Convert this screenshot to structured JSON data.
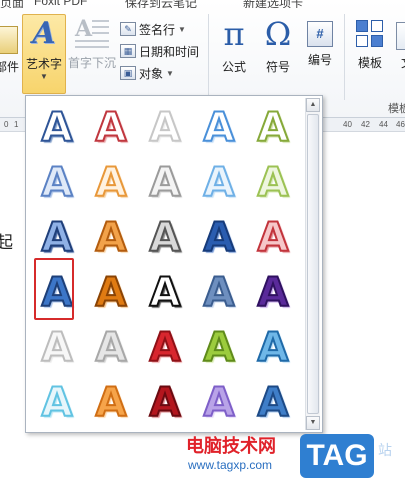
{
  "tabs": [
    "页面",
    "Foxit PDF",
    "保存到云笔记",
    "新建选项卡"
  ],
  "ribbon": {
    "attachment_label": "部件",
    "wordart_label": "艺术字",
    "dropcap_label": "首字下沉",
    "signature_line": "签名行",
    "date_time": "日期和时间",
    "object": "对象",
    "formula": "公式",
    "symbol": "符号",
    "number": "编号",
    "template": "模板",
    "text_partial": "文",
    "group_template": "模板",
    "formula_glyph": "π",
    "symbol_glyph": "Ω",
    "number_glyph": "#"
  },
  "ruler": {
    "left": [
      "0",
      "1"
    ],
    "right": [
      "40",
      "42",
      "44",
      "46"
    ]
  },
  "document": {
    "visible_text": "起"
  },
  "gallery": {
    "glyph": "A",
    "selected_index": 15,
    "styles": [
      {
        "fill": "#ffffff",
        "stroke": "#2f5597",
        "shadow": "#7f9cc8"
      },
      {
        "fill": "#ffffff",
        "stroke": "#c0373f",
        "shadow": "#e8a2a5"
      },
      {
        "fill": "#ffffff",
        "stroke": "#c7c7c7",
        "shadow": "#eeeeee"
      },
      {
        "fill": "#ffffff",
        "stroke": "#4a90d9",
        "shadow": "#bfdaf5"
      },
      {
        "fill": "#ffffff",
        "stroke": "#86a93a",
        "shadow": "#cfe0a5"
      },
      {
        "fill": "#dfe9f8",
        "stroke": "#5b82c4",
        "shadow": "#a8c0e6"
      },
      {
        "fill": "#fff2e0",
        "stroke": "#e8983a",
        "shadow": "#f5cf9e"
      },
      {
        "fill": "#f4f4f4",
        "stroke": "#9b9b9b",
        "shadow": "#d6d6d6"
      },
      {
        "fill": "#eaf4fc",
        "stroke": "#6fb0e6",
        "shadow": "#c6e1f6"
      },
      {
        "fill": "#eef6df",
        "stroke": "#9cc254",
        "shadow": "#d6e8b6"
      },
      {
        "fill": "#8fb1e6",
        "stroke": "#1f3f7a",
        "shadow": "#4a6aa5"
      },
      {
        "fill": "#f2a24a",
        "stroke": "#b35c0e",
        "shadow": "#f8d3a6"
      },
      {
        "fill": "#d9d9d9",
        "stroke": "#555555",
        "shadow": "#8a8a8a"
      },
      {
        "fill": "#2a5db0",
        "stroke": "#163b7a",
        "shadow": "#6f95d4"
      },
      {
        "fill": "#f6c7c9",
        "stroke": "#c2343c",
        "shadow": "#e38f93"
      },
      {
        "fill": "#3c76c8",
        "stroke": "#1d3f78",
        "shadow": "#a9c3ea"
      },
      {
        "fill": "#e07b12",
        "stroke": "#8a4304",
        "shadow": "#f4c289"
      },
      {
        "fill": "#ffffff",
        "stroke": "#111111",
        "shadow": "#555555"
      },
      {
        "fill": "#6e8fbf",
        "stroke": "#3b5d8f",
        "shadow": "#c4d4ec"
      },
      {
        "fill": "#5a2a9a",
        "stroke": "#2f1160",
        "shadow": "#c4a7e8"
      },
      {
        "fill": "#f7f7f7",
        "stroke": "#bdbdbd",
        "shadow": "#e9e9e9"
      },
      {
        "fill": "#e6e6e6",
        "stroke": "#a8a8a8",
        "shadow": "#d2d2d2"
      },
      {
        "fill": "#d8262e",
        "stroke": "#8f1016",
        "shadow": "#f0a4a7"
      },
      {
        "fill": "#9ccc3d",
        "stroke": "#5f8b1a",
        "shadow": "#d8ebb0"
      },
      {
        "fill": "#6fb7e8",
        "stroke": "#1f6aa8",
        "shadow": "#bfe0f6"
      },
      {
        "fill": "#e7f6fb",
        "stroke": "#61c3e2",
        "shadow": "#b9e6f4"
      },
      {
        "fill": "#f6a44a",
        "stroke": "#d06e14",
        "shadow": "#fbd5a7"
      },
      {
        "fill": "#b3161e",
        "stroke": "#6a0a10",
        "shadow": "#d98387"
      },
      {
        "fill": "#b9a3e8",
        "stroke": "#7e5fc8",
        "shadow": "#e3d8f8"
      },
      {
        "fill": "#3f7ec8",
        "stroke": "#1d4a86",
        "shadow": "#a9c9ee"
      }
    ]
  },
  "watermark": {
    "site_name": "电脑技术网",
    "url": "www.tagxp.com",
    "tag": "TAG",
    "side": "站"
  }
}
